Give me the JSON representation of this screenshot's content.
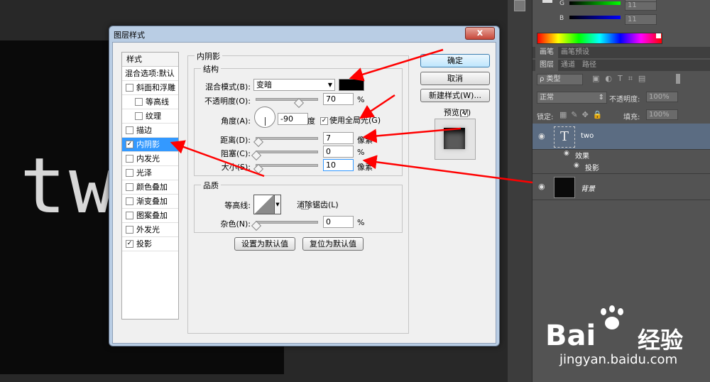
{
  "canvas": {
    "text": "tw"
  },
  "panel": {
    "channel_g": "G",
    "channel_b": "B",
    "value_g": "11",
    "value_b": "11",
    "value_top": "11",
    "tabs_top": [
      "画笔",
      "画笔预设"
    ],
    "tabs_layers": [
      "图层",
      "通道",
      "路径"
    ],
    "filter_kind": "ρ 类型",
    "blend_mode": "正常",
    "opacity_label": "不透明度:",
    "opacity_value": "100%",
    "lock_label": "锁定:",
    "fill_label": "填充:",
    "fill_value": "100%",
    "layers": [
      {
        "name": "two",
        "thumb": "T"
      },
      {
        "name": "效果"
      },
      {
        "name": "投影"
      },
      {
        "name": "背景"
      }
    ]
  },
  "dialog": {
    "title": "图层样式",
    "close": "x",
    "styles_header": "样式",
    "blend_options": "混合选项:默认",
    "styles": [
      {
        "label": "斜面和浮雕",
        "checked": false
      },
      {
        "label": "等高线",
        "checked": false
      },
      {
        "label": "纹理",
        "checked": false
      },
      {
        "label": "描边",
        "checked": false
      },
      {
        "label": "内阴影",
        "checked": true
      },
      {
        "label": "内发光",
        "checked": false
      },
      {
        "label": "光泽",
        "checked": false
      },
      {
        "label": "颜色叠加",
        "checked": false
      },
      {
        "label": "渐变叠加",
        "checked": false
      },
      {
        "label": "图案叠加",
        "checked": false
      },
      {
        "label": "外发光",
        "checked": false
      },
      {
        "label": "投影",
        "checked": true
      }
    ],
    "section_title": "内阴影",
    "structure_title": "结构",
    "blend_mode_label": "混合模式(B):",
    "blend_mode_value": "变暗",
    "shadow_color": "#000000",
    "opacity_label": "不透明度(O):",
    "opacity_value": "70",
    "opacity_unit": "%",
    "angle_label": "角度(A):",
    "angle_value": "-90",
    "angle_unit": "度",
    "global_light_label": "使用全局光(G)",
    "distance_label": "距离(D):",
    "distance_value": "7",
    "distance_unit": "像素",
    "choke_label": "阻塞(C):",
    "choke_value": "0",
    "choke_unit": "%",
    "size_label": "大小(S):",
    "size_value": "10",
    "size_unit": "像素",
    "quality_title": "品质",
    "contour_label": "等高线:",
    "antialias_label": "消除锯齿(L)",
    "noise_label": "杂色(N):",
    "noise_value": "0",
    "noise_unit": "%",
    "set_default": "设置为默认值",
    "reset_default": "复位为默认值",
    "ok": "确定",
    "cancel": "取消",
    "new_style": "新建样式(W)...",
    "preview_label": "预览(V)"
  },
  "sliders": {
    "opacity": 0.7,
    "distance": 0.03,
    "choke": 0.0,
    "size": 0.04,
    "noise": 0.0
  },
  "watermark": {
    "brand_a": "Bai",
    "brand_b": "经验",
    "url": "jingyan.baidu.com"
  },
  "colors": {
    "accent": "#3399ff",
    "arrow": "#ff0000"
  }
}
